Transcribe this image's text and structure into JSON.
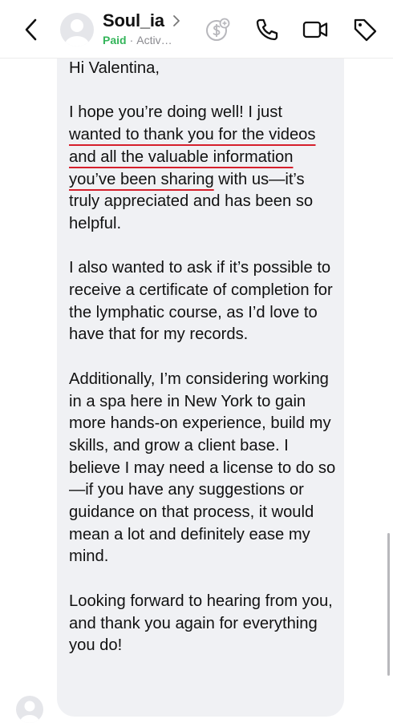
{
  "header": {
    "contact_name": "Soul_ia",
    "status_paid": "Paid",
    "status_separator": "·",
    "status_active": "Activ…",
    "icons": {
      "back": "chevron-left-icon",
      "name_chevron": "chevron-right-icon",
      "money": "money-sign-icon",
      "call": "phone-icon",
      "video": "video-camera-icon",
      "tag": "tag-icon"
    }
  },
  "message": {
    "greeting": "Hi Valentina,",
    "p1_start": "I hope you’re doing well! I just ",
    "p1_highlight": "wanted to thank you for the videos and all the valuable information you’ve been sharing",
    "p1_end": " with us—it’s truly appreciated and has been so helpful.",
    "p2": "I also wanted to ask if it’s possible to receive a certificate of completion for the lymphatic course, as I’d love to have that for my records.",
    "p3": "Additionally, I’m considering working in a spa here in New York to gain more hands-on experience, build my skills, and grow a client base. I believe I may need a license to do so—if you have any suggestions or guidance on that process, it would mean a lot and definitely ease my mind.",
    "p4": "Looking forward to hearing from you, and thank you again for everything you do!"
  },
  "colors": {
    "paid": "#34b55a",
    "bubble": "#f0f1f4",
    "underline": "#d61f2c"
  }
}
